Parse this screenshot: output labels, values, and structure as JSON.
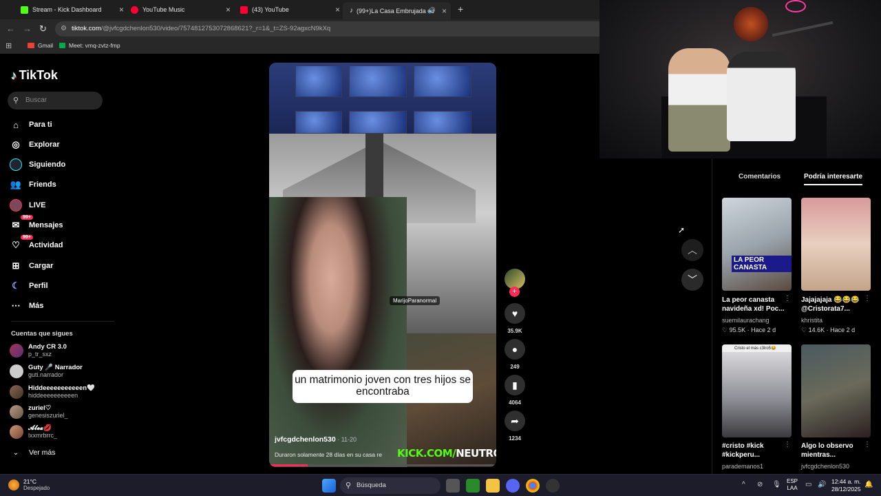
{
  "browser": {
    "tabs": [
      {
        "title": "Stream - Kick Dashboard",
        "color": "#53fc18"
      },
      {
        "title": "YouTube Music",
        "color": "#ff0033"
      },
      {
        "title": "(43) YouTube",
        "color": "#ff0033"
      },
      {
        "title": "(99+)La Casa Embrujada de",
        "color": "#ffffff"
      }
    ],
    "new_tab": "+",
    "url_domain": "tiktok.com",
    "url_rest": "/@jvfcgdchenlon530/video/7574812753072868621?_r=1&_t=ZS-92agxcN9kXq",
    "bookmarks": [
      "Gmail",
      "Meet: vmq-zvtz-fmp"
    ]
  },
  "tiktok": {
    "logo": "TikTok",
    "search_placeholder": "Buscar",
    "nav": [
      {
        "label": "Para ti",
        "icon": "home-icon"
      },
      {
        "label": "Explorar",
        "icon": "compass-icon"
      },
      {
        "label": "Siguiendo",
        "icon": "following-icon"
      },
      {
        "label": "Friends",
        "icon": "friends-icon"
      },
      {
        "label": "LIVE",
        "icon": "live-icon"
      },
      {
        "label": "Mensajes",
        "icon": "messages-icon",
        "badge": "99+"
      },
      {
        "label": "Actividad",
        "icon": "activity-icon",
        "badge": "99+"
      },
      {
        "label": "Cargar",
        "icon": "upload-icon"
      },
      {
        "label": "Perfil",
        "icon": "profile-icon"
      },
      {
        "label": "Más",
        "icon": "more-icon"
      }
    ],
    "following_title": "Cuentas que sigues",
    "accounts": [
      {
        "name": "Andy CR 3.0",
        "handle": "p_tr_sxz"
      },
      {
        "name": "Guty 🎤 Narrador",
        "handle": "guti.narrador"
      },
      {
        "name": "Hiddeeeeeeeeeeen🤍",
        "handle": "hiddeeeeeeeeeen"
      },
      {
        "name": "zuriel♡",
        "handle": "genesiszuriel_"
      },
      {
        "name": "𝓐𝓵𝓮𝔁💋",
        "handle": "lxxmrbrrc_"
      }
    ],
    "see_more": "Ver más"
  },
  "video": {
    "caption": "un matrimonio joven con tres hijos se encontraba",
    "watermark": "MarijoParanormal",
    "username": "jvfcgdchenlon530",
    "time": " · 11-20",
    "description": "Duraron solamente 28 días en su casa re",
    "overlay_kick": "KICK.COM/",
    "overlay_name": "NEUTROYT",
    "progress": 0.17,
    "likes": "35.9K",
    "comments": "249",
    "saves": "4064",
    "shares": "1234"
  },
  "right_panel": {
    "tab_comments": "Comentarios",
    "tab_related": "Podría interesarte",
    "cards": [
      {
        "title": "La peor canasta navideña xd! Poc...",
        "author": "suemilaurachang",
        "stat": "♡ 95.5K · Hace 2 d",
        "overlay": "LA PEOR CANASTA"
      },
      {
        "title": "Jajajajaja 😂😂😂 @Cristorata7...",
        "author": "khristita",
        "stat": "♡ 14.6K · Hace 2 d",
        "overlay": ""
      },
      {
        "title": "#cristo #kick #kickperu...",
        "author": "parademanos1",
        "stat": "",
        "overlay": "Cristo el más c3lro5😂"
      },
      {
        "title": "Algo lo observo mientras...",
        "author": "jvfcgdchenlon530",
        "stat": "",
        "overlay": ""
      }
    ]
  },
  "taskbar": {
    "temp": "21°C",
    "weather": "Despejado",
    "search": "Búsqueda",
    "lang1": "ESP",
    "lang2": "LAA",
    "time": "12:44 a. m.",
    "date": "28/12/2025"
  }
}
